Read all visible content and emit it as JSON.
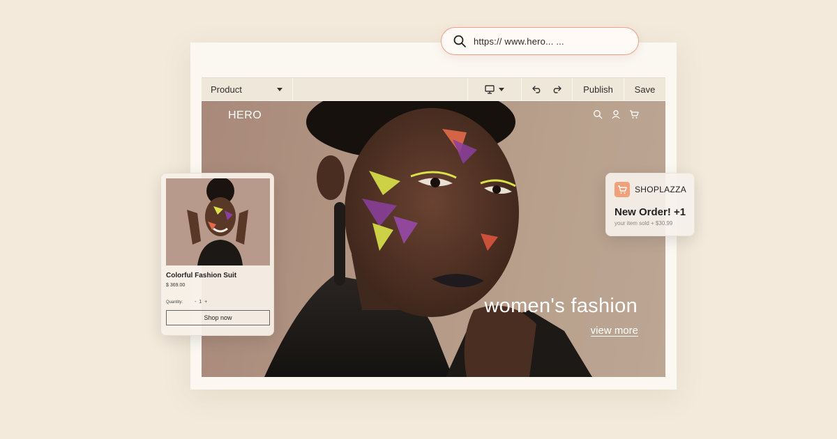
{
  "url_bar": {
    "url": "https:// www.hero... ..."
  },
  "toolbar": {
    "section_select": "Product",
    "publish_label": "Publish",
    "save_label": "Save"
  },
  "hero": {
    "brand": "HERO",
    "headline": "women's fashion",
    "link": "view more"
  },
  "product_card": {
    "name": "Colorful Fashion Suit",
    "price": "$ 369.00",
    "quantity_label": "Quantity:",
    "quantity_control": "- 1 +",
    "button_label": "Shop now"
  },
  "notification": {
    "brand": "SHOPLAZZA",
    "title": "New Order! +1",
    "subtitle": "your item sold + $30.99"
  },
  "colors": {
    "background": "#f3eadc",
    "accent": "#e9a489",
    "toolbar": "#efe7da",
    "hero_bg": "#b39684"
  },
  "icons": [
    "search-icon",
    "chevron-down-icon",
    "desktop-icon",
    "undo-icon",
    "redo-icon",
    "user-icon",
    "cart-icon"
  ]
}
